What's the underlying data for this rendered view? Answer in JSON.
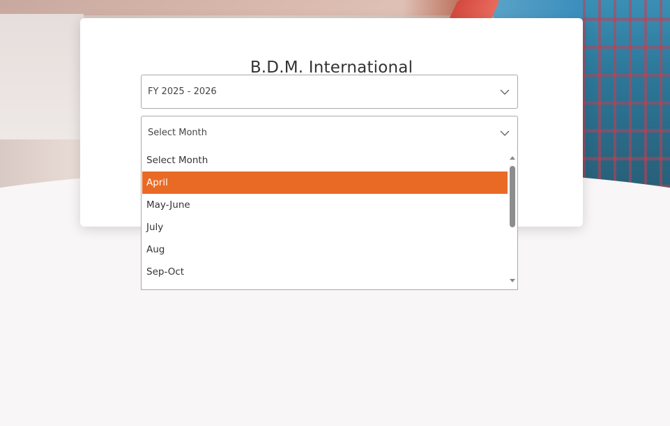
{
  "card": {
    "title": "B.D.M. International"
  },
  "fy_select": {
    "value": "FY 2025 - 2026"
  },
  "month_select": {
    "value": "Select Month",
    "options": [
      "Select Month",
      "April",
      "May-June",
      "July",
      "Aug",
      "Sep-Oct"
    ],
    "highlighted": "April"
  },
  "colors": {
    "accent": "#e96a24"
  },
  "icons": {
    "dropdown": "chevron-down-icon"
  }
}
